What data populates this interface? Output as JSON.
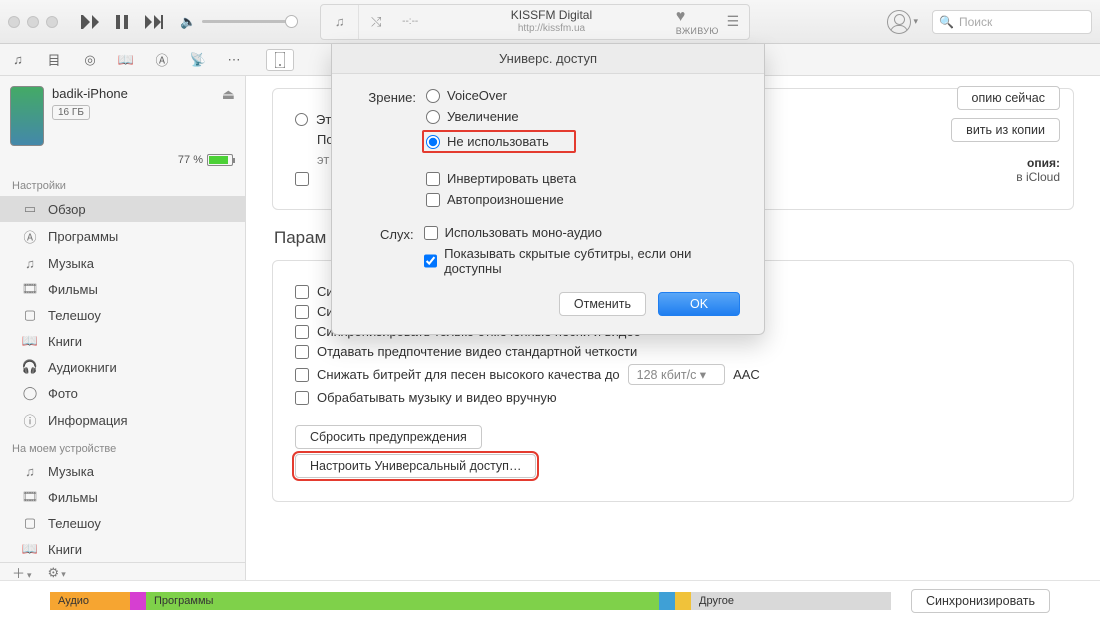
{
  "titlebar": {
    "station_title": "KISSFM Digital",
    "station_url": "http://kissfm.ua",
    "time_placeholder": "--:--",
    "live_label": "ВЖИВУЮ",
    "search_placeholder": "Поиск"
  },
  "sidebar": {
    "device_name": "badik-iPhone",
    "capacity_badge": "16 ГБ",
    "battery_pct": "77 %",
    "section_settings": "Настройки",
    "section_ondevice": "На моем устройстве",
    "settings_items": [
      "Обзор",
      "Программы",
      "Музыка",
      "Фильмы",
      "Телешоу",
      "Книги",
      "Аудиокниги",
      "Фото",
      "Информация"
    ],
    "device_items": [
      "Музыка",
      "Фильмы",
      "Телешоу",
      "Книги"
    ]
  },
  "peek": {
    "btn_backup_now": "опию сейчас",
    "btn_restore": "вить из копии",
    "label_copy": "опия:",
    "label_icloud": "в iCloud"
  },
  "content": {
    "section_params": "Парам",
    "chk_this": "Эт",
    "chk_after": "По",
    "chk_sync_wifi": "Синхронизировать с этим iPhone по Wi-Fi",
    "chk_sync_checked": "Синхронизировать только отмеченные песни и видео",
    "chk_prefer_sd": "Отдавать предпочтение видео стандартной четкости",
    "chk_bitrate": "Снижать битрейт для песен высокого качества до",
    "bitrate_value": "128 кбит/с",
    "bitrate_codec": "AAC",
    "chk_manual": "Обрабатывать музыку и видео вручную",
    "btn_reset_warnings": "Сбросить предупреждения",
    "btn_configure_access": "Настроить Универсальный доступ…",
    "chk_si": "Си"
  },
  "sheet": {
    "title": "Универс. доступ",
    "label_vision": "Зрение:",
    "opt_voiceover": "VoiceOver",
    "opt_zoom": "Увеличение",
    "opt_none": "Не использовать",
    "chk_invert": "Инвертировать цвета",
    "chk_speak": "Автопроизношение",
    "label_hearing": "Слух:",
    "chk_mono": "Использовать моно-аудио",
    "chk_captions": "Показывать скрытые субтитры, если они доступны",
    "btn_cancel": "Отменить",
    "btn_ok": "OK"
  },
  "footer": {
    "seg_audio": "Аудио",
    "seg_apps": "Программы",
    "seg_other": "Другое",
    "btn_sync": "Синхронизировать"
  }
}
